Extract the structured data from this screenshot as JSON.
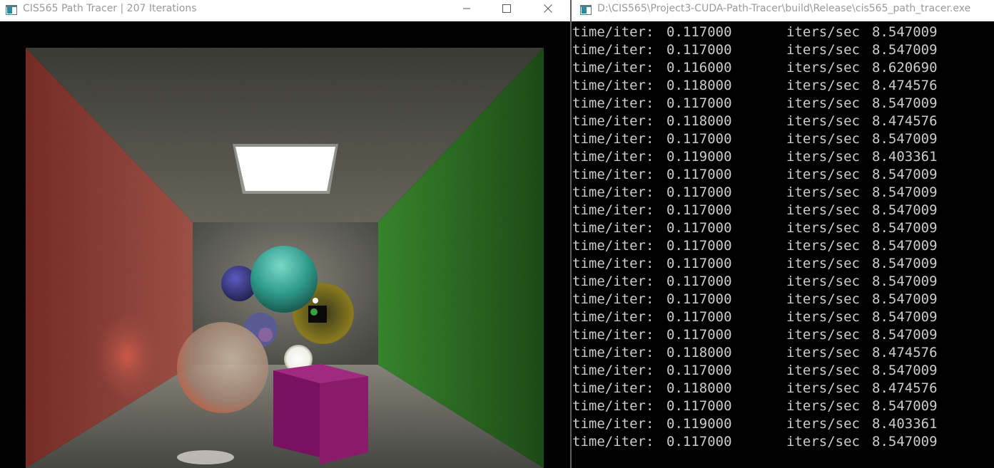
{
  "render_window": {
    "title": "CIS565 Path Tracer | 207 Iterations",
    "icon": "app-window-icon",
    "controls": {
      "minimize_icon": "minimize-icon",
      "maximize_icon": "maximize-icon",
      "close_icon": "close-icon"
    }
  },
  "console_window": {
    "title": "D:\\CIS565\\Project3-CUDA-Path-Tracer\\build\\Release\\cis565_path_tracer.exe",
    "icon": "console-window-icon",
    "lines": [
      {
        "k1": "time/iter:",
        "v1": "0.117000",
        "k2": "iters/sec",
        "v2": "8.547009"
      },
      {
        "k1": "time/iter:",
        "v1": "0.117000",
        "k2": "iters/sec",
        "v2": "8.547009"
      },
      {
        "k1": "time/iter:",
        "v1": "0.116000",
        "k2": "iters/sec",
        "v2": "8.620690"
      },
      {
        "k1": "time/iter:",
        "v1": "0.118000",
        "k2": "iters/sec",
        "v2": "8.474576"
      },
      {
        "k1": "time/iter:",
        "v1": "0.117000",
        "k2": "iters/sec",
        "v2": "8.547009"
      },
      {
        "k1": "time/iter:",
        "v1": "0.118000",
        "k2": "iters/sec",
        "v2": "8.474576"
      },
      {
        "k1": "time/iter:",
        "v1": "0.117000",
        "k2": "iters/sec",
        "v2": "8.547009"
      },
      {
        "k1": "time/iter:",
        "v1": "0.119000",
        "k2": "iters/sec",
        "v2": "8.403361"
      },
      {
        "k1": "time/iter:",
        "v1": "0.117000",
        "k2": "iters/sec",
        "v2": "8.547009"
      },
      {
        "k1": "time/iter:",
        "v1": "0.117000",
        "k2": "iters/sec",
        "v2": "8.547009"
      },
      {
        "k1": "time/iter:",
        "v1": "0.117000",
        "k2": "iters/sec",
        "v2": "8.547009"
      },
      {
        "k1": "time/iter:",
        "v1": "0.117000",
        "k2": "iters/sec",
        "v2": "8.547009"
      },
      {
        "k1": "time/iter:",
        "v1": "0.117000",
        "k2": "iters/sec",
        "v2": "8.547009"
      },
      {
        "k1": "time/iter:",
        "v1": "0.117000",
        "k2": "iters/sec",
        "v2": "8.547009"
      },
      {
        "k1": "time/iter:",
        "v1": "0.117000",
        "k2": "iters/sec",
        "v2": "8.547009"
      },
      {
        "k1": "time/iter:",
        "v1": "0.117000",
        "k2": "iters/sec",
        "v2": "8.547009"
      },
      {
        "k1": "time/iter:",
        "v1": "0.117000",
        "k2": "iters/sec",
        "v2": "8.547009"
      },
      {
        "k1": "time/iter:",
        "v1": "0.117000",
        "k2": "iters/sec",
        "v2": "8.547009"
      },
      {
        "k1": "time/iter:",
        "v1": "0.118000",
        "k2": "iters/sec",
        "v2": "8.474576"
      },
      {
        "k1": "time/iter:",
        "v1": "0.117000",
        "k2": "iters/sec",
        "v2": "8.547009"
      },
      {
        "k1": "time/iter:",
        "v1": "0.118000",
        "k2": "iters/sec",
        "v2": "8.474576"
      },
      {
        "k1": "time/iter:",
        "v1": "0.117000",
        "k2": "iters/sec",
        "v2": "8.547009"
      },
      {
        "k1": "time/iter:",
        "v1": "0.119000",
        "k2": "iters/sec",
        "v2": "8.403361"
      },
      {
        "k1": "time/iter:",
        "v1": "0.117000",
        "k2": "iters/sec",
        "v2": "8.547009"
      }
    ]
  },
  "scene": {
    "left_wall_color": "#8a3a30",
    "right_wall_color": "#2e6a24",
    "back_wall_color": "#5a5a52",
    "light_color": "#ffffff",
    "cube_color": "#8a1a6a",
    "teal_sphere_color": "#3aa89a",
    "blue_sphere_color": "#3a3a9a",
    "glass_sphere_color": "#c09070",
    "gold_sphere_color": "#8a7a20"
  }
}
